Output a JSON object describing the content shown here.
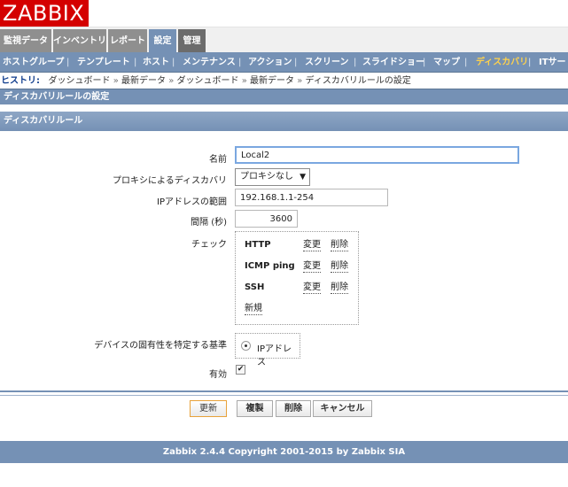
{
  "logo": "ZABBIX",
  "main_menu": [
    {
      "label": "監視データ"
    },
    {
      "label": "インベントリ"
    },
    {
      "label": "レポート"
    },
    {
      "label": "設定"
    },
    {
      "label": "管理"
    }
  ],
  "sub_menu": [
    {
      "label": "ホストグループ"
    },
    {
      "label": "テンプレート"
    },
    {
      "label": "ホスト"
    },
    {
      "label": "メンテナンス"
    },
    {
      "label": "アクション"
    },
    {
      "label": "スクリーン"
    },
    {
      "label": "スライドショー"
    },
    {
      "label": "マップ"
    },
    {
      "label": "ディスカバリ"
    },
    {
      "label": "ITサー"
    }
  ],
  "history": {
    "label": "ヒストリ:",
    "items": [
      "ダッシュボード",
      "最新データ",
      "ダッシュボード",
      "最新データ",
      "ディスカバリルールの設定"
    ],
    "separator": "»"
  },
  "page_title": "ディスカバリルールの設定",
  "section_title": "ディスカバリルール",
  "form": {
    "name_label": "名前",
    "name_value": "Local2",
    "proxy_label": "プロキシによるディスカバリ",
    "proxy_value": "プロキシなし",
    "iprange_label": "IPアドレスの範囲",
    "iprange_value": "192.168.1.1-254",
    "interval_label": "間隔 (秒)",
    "interval_value": "3600",
    "checks_label": "チェック",
    "checks": [
      {
        "name": "HTTP",
        "edit": "変更",
        "remove": "削除"
      },
      {
        "name": "ICMP ping",
        "edit": "変更",
        "remove": "削除"
      },
      {
        "name": "SSH",
        "edit": "変更",
        "remove": "削除"
      }
    ],
    "new_check": "新規",
    "uniqueness_label": "デバイスの固有性を特定する基準",
    "uniqueness_value": "IPアドレス",
    "enabled_label": "有効",
    "enabled_checked": true
  },
  "buttons": {
    "update": "更新",
    "clone": "複製",
    "delete": "削除",
    "cancel": "キャンセル"
  },
  "footer": "Zabbix 2.4.4 Copyright 2001-2015 by Zabbix SIA",
  "colors": {
    "brand": "#d40000",
    "nav": "#7591b5",
    "selected": "#ffd24c"
  }
}
